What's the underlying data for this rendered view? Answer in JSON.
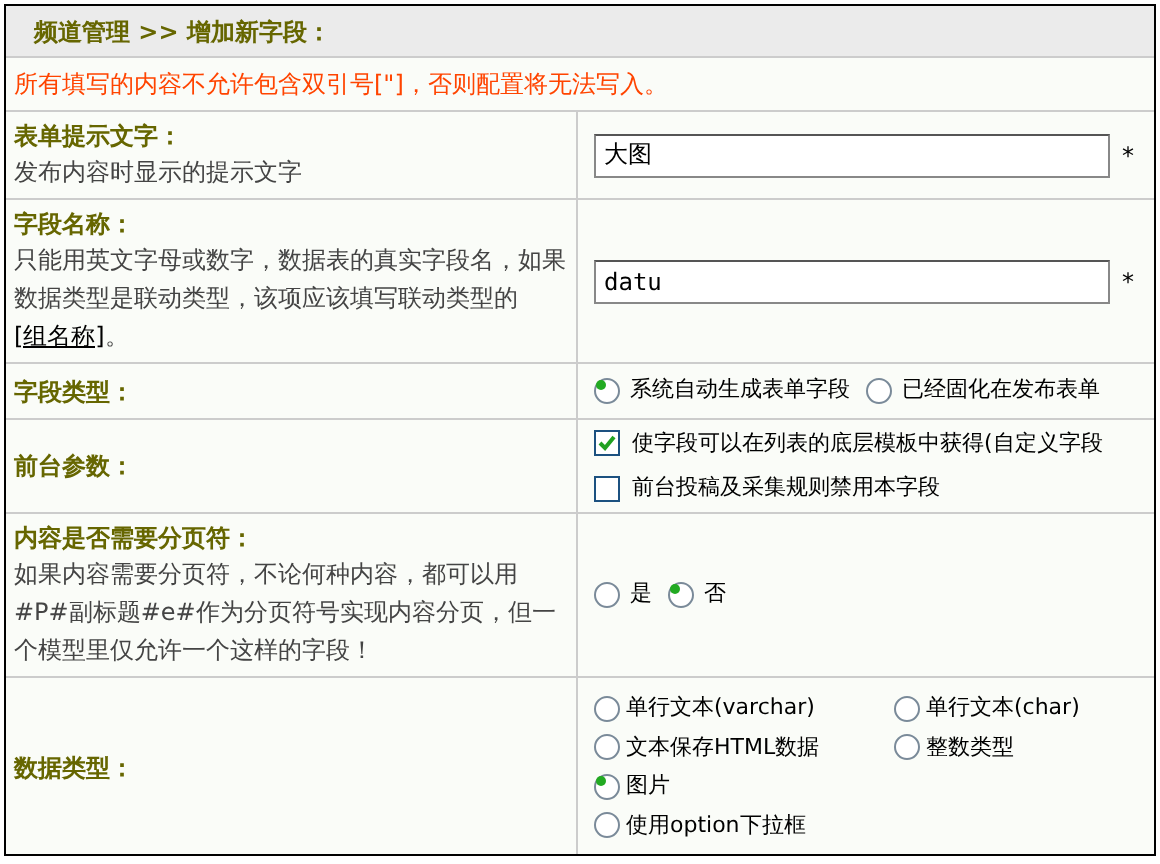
{
  "header": {
    "breadcrumb": "频道管理 >> 增加新字段："
  },
  "notice": "所有填写的内容不允许包含双引号[\"]，否则配置将无法写入。",
  "rows": [
    {
      "kind": "text",
      "label": "表单提示文字：",
      "help": "发布内容时显示的提示文字",
      "value": "大图",
      "required": "*"
    },
    {
      "kind": "text",
      "label": "字段名称：",
      "help": "只能用英文字母或数字，数据表的真实字段名，如果数据类型是联动类型，该项应该填写联动类型的",
      "help_link": "[组名称]",
      "help_end": "。",
      "value": "datu",
      "mono": true,
      "required": "*"
    },
    {
      "kind": "radio",
      "label": "字段类型：",
      "options": [
        {
          "label": "系统自动生成表单字段",
          "selected": true
        },
        {
          "label": "已经固化在发布表单",
          "selected": false
        }
      ]
    },
    {
      "kind": "check",
      "label": "前台参数：",
      "options": [
        {
          "label": "使字段可以在列表的底层模板中获得(自定义字段",
          "checked": true
        },
        {
          "label": "前台投稿及采集规则禁用本字段",
          "checked": false
        }
      ]
    },
    {
      "kind": "radio",
      "label": "内容是否需要分页符：",
      "help": "如果内容需要分页符，不论何种内容，都可以用#P#副标题#e#作为分页符号实现内容分页，但一个模型里仅允许一个这样的字段！",
      "options": [
        {
          "label": "是",
          "selected": false
        },
        {
          "label": "否",
          "selected": true
        }
      ]
    },
    {
      "kind": "grid",
      "label": "数据类型：",
      "options": [
        {
          "label": "单行文本(varchar)",
          "selected": false
        },
        {
          "label": "单行文本(char)",
          "selected": false
        },
        {
          "label": "文本保存HTML数据",
          "selected": false
        },
        {
          "label": "整数类型",
          "selected": false
        },
        {
          "label": "图片",
          "selected": true
        },
        {
          "label": "使用option下拉框",
          "selected": false
        }
      ]
    }
  ]
}
